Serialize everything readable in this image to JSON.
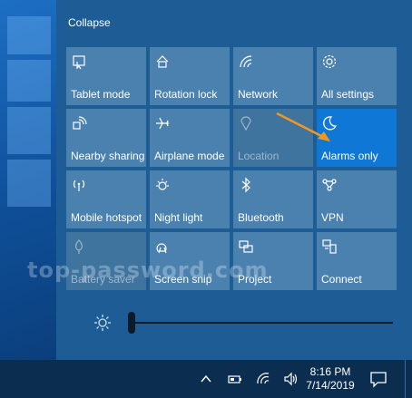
{
  "action_center": {
    "collapse_label": "Collapse",
    "tiles": [
      {
        "label": "Tablet mode",
        "icon": "tablet-mode-icon",
        "state": "off"
      },
      {
        "label": "Rotation lock",
        "icon": "rotation-lock-icon",
        "state": "off"
      },
      {
        "label": "Network",
        "icon": "network-icon",
        "state": "off"
      },
      {
        "label": "All settings",
        "icon": "gear-icon",
        "state": "off"
      },
      {
        "label": "Nearby sharing",
        "icon": "nearby-sharing-icon",
        "state": "off"
      },
      {
        "label": "Airplane mode",
        "icon": "airplane-icon",
        "state": "off"
      },
      {
        "label": "Location",
        "icon": "location-icon",
        "state": "disabled"
      },
      {
        "label": "Alarms only",
        "icon": "moon-icon",
        "state": "on"
      },
      {
        "label": "Mobile hotspot",
        "icon": "mobile-hotspot-icon",
        "state": "off"
      },
      {
        "label": "Night light",
        "icon": "night-light-icon",
        "state": "off"
      },
      {
        "label": "Bluetooth",
        "icon": "bluetooth-icon",
        "state": "off"
      },
      {
        "label": "VPN",
        "icon": "vpn-icon",
        "state": "off"
      },
      {
        "label": "Battery saver",
        "icon": "battery-saver-icon",
        "state": "disabled"
      },
      {
        "label": "Screen snip",
        "icon": "screen-snip-icon",
        "state": "off"
      },
      {
        "label": "Project",
        "icon": "project-icon",
        "state": "off"
      },
      {
        "label": "Connect",
        "icon": "connect-icon",
        "state": "off"
      }
    ],
    "brightness": {
      "icon": "sun-icon",
      "level": 0
    }
  },
  "taskbar": {
    "time": "8:16 PM",
    "date": "7/14/2019",
    "tray_icons": [
      "chevron-up-icon",
      "battery-icon",
      "wifi-icon",
      "volume-icon"
    ],
    "notification_icon": "notification-icon"
  },
  "watermark": "top-password.com",
  "colors": {
    "panel": "#1d5c95",
    "tile": "#4a81ae",
    "tile_active": "#0f78d7",
    "taskbar": "#0b2d50",
    "arrow": "#f5961e"
  }
}
